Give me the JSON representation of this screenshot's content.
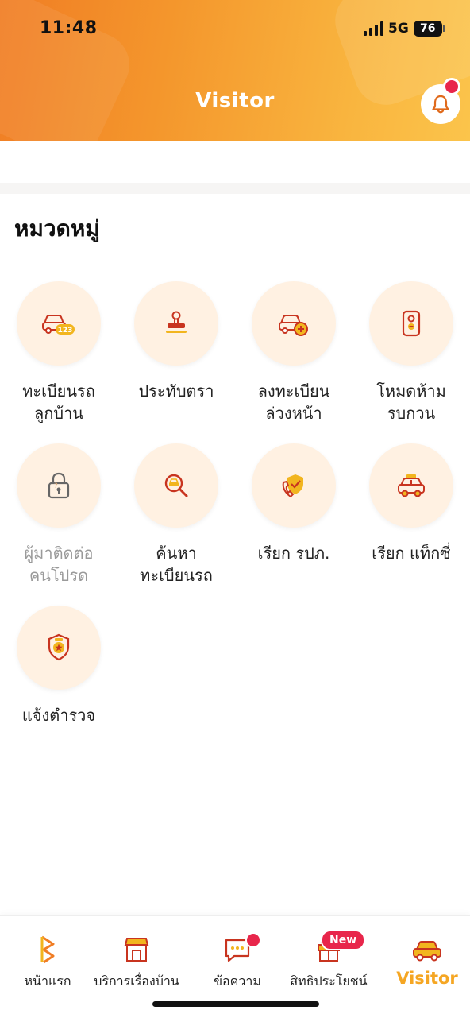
{
  "status_bar": {
    "time": "11:48",
    "network": "5G",
    "battery": "76"
  },
  "header": {
    "title": "Visitor"
  },
  "section": {
    "title": "หมวดหมู่"
  },
  "categories": [
    {
      "line1": "ทะเบียนรถ",
      "line2": "ลูกบ้าน",
      "icon": "car-123-icon"
    },
    {
      "line1": "ประทับตรา",
      "line2": "",
      "icon": "stamp-icon"
    },
    {
      "line1": "ลงทะเบียน",
      "line2": "ล่วงหน้า",
      "icon": "car-add-icon"
    },
    {
      "line1": "โหมดห้าม",
      "line2": "รบกวน",
      "icon": "do-not-disturb-icon"
    },
    {
      "line1": "ผู้มาติดต่อ",
      "line2": "คนโปรด",
      "icon": "lock-icon",
      "disabled": true
    },
    {
      "line1": "ค้นหา",
      "line2": "ทะเบียนรถ",
      "icon": "search-car-icon"
    },
    {
      "line1": "เรียก รปภ.",
      "line2": "",
      "icon": "security-call-icon"
    },
    {
      "line1": "เรียก แท็กซี่",
      "line2": "",
      "icon": "taxi-icon"
    },
    {
      "line1": "แจ้งตำรวจ",
      "line2": "",
      "icon": "police-badge-icon"
    }
  ],
  "bottom_nav": [
    {
      "label": "หน้าแรก",
      "icon": "home-logo-icon"
    },
    {
      "label": "บริการเรื่องบ้าน",
      "icon": "house-service-icon"
    },
    {
      "label": "ข้อความ",
      "icon": "message-icon"
    },
    {
      "label": "สิทธิประโยชน์",
      "icon": "gift-icon",
      "badge": "New"
    },
    {
      "label": "Visitor",
      "icon": "car-icon",
      "active": true
    }
  ],
  "colors": {
    "accent": "#f5a623",
    "icon_red": "#c8341f",
    "icon_yellow": "#f2b51e",
    "badge": "#e8264b"
  }
}
